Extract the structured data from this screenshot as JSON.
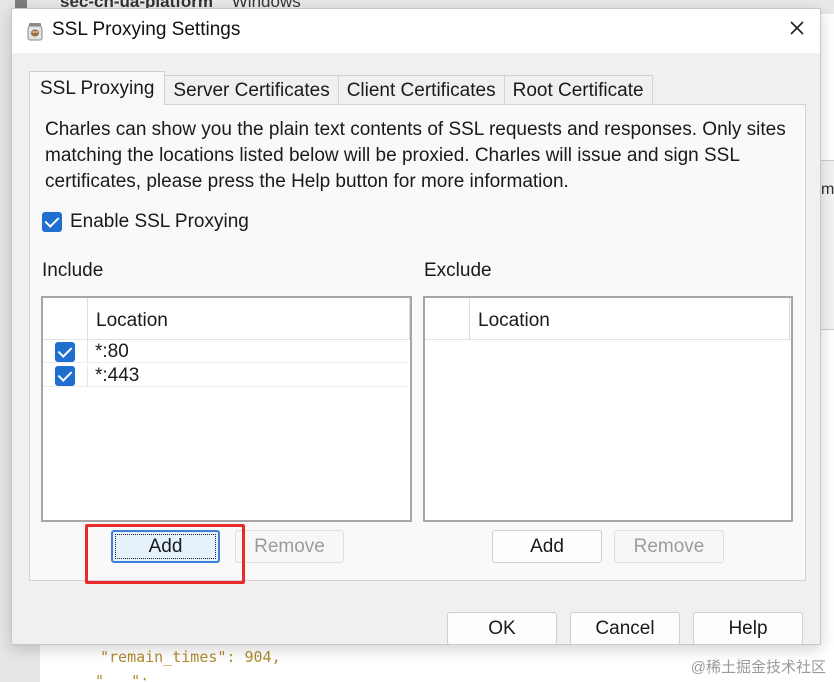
{
  "background": {
    "header_field": "sec-ch-ua-platform",
    "header_value": "Windows",
    "right_edge_letter": "m",
    "code_line_1": "\"remain_times\": 904,",
    "code_line_2": "\"...\": ..."
  },
  "watermark": "@稀土掘金技术社区",
  "dialog": {
    "title": "SSL Proxying Settings",
    "tabs": [
      {
        "label": "SSL Proxying",
        "active": true
      },
      {
        "label": "Server Certificates",
        "active": false
      },
      {
        "label": "Client Certificates",
        "active": false
      },
      {
        "label": "Root Certificate",
        "active": false
      }
    ],
    "description": "Charles can show you the plain text contents of SSL requests and responses. Only sites matching the locations listed below will be proxied. Charles will issue and sign SSL certificates, please press the Help button for more information.",
    "enable_label": "Enable SSL Proxying",
    "include": {
      "label": "Include",
      "column": "Location",
      "rows": [
        {
          "location": "*:80",
          "checked": true
        },
        {
          "location": "*:443",
          "checked": true
        }
      ],
      "add_label": "Add",
      "remove_label": "Remove"
    },
    "exclude": {
      "label": "Exclude",
      "column": "Location",
      "rows": [],
      "add_label": "Add",
      "remove_label": "Remove"
    },
    "footer": {
      "ok": "OK",
      "cancel": "Cancel",
      "help": "Help"
    }
  },
  "colors": {
    "checkbox": "#1f6fd1",
    "highlight": "#ea2a2a",
    "focus_border": "#3d7fd6"
  },
  "icons": {
    "title": "charles-jar-icon",
    "close": "close-icon"
  }
}
